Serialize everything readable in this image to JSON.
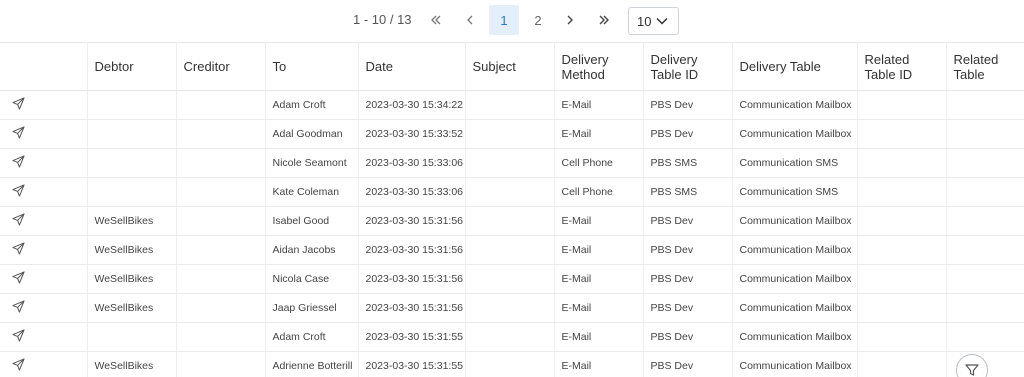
{
  "pager": {
    "range": "1 - 10 / 13",
    "first_label": "«",
    "prev_label": "‹",
    "pages": [
      "1",
      "2"
    ],
    "next_label": "›",
    "last_label": "»",
    "page_size": "10"
  },
  "table": {
    "headers": [
      "",
      "Debtor",
      "Creditor",
      "To",
      "Date",
      "Subject",
      "Delivery Method",
      "Delivery Table ID",
      "Delivery Table",
      "Related Table ID",
      "Related Table"
    ],
    "rows": [
      {
        "debtor": "",
        "creditor": "",
        "to": "Adam Croft",
        "date": "2023-03-30 15:34:22",
        "subject": "",
        "method": "E-Mail",
        "table_id": "PBS Dev",
        "table": "Communication Mailbox",
        "rel_id": "",
        "rel_table": ""
      },
      {
        "debtor": "",
        "creditor": "",
        "to": "Adal Goodman",
        "date": "2023-03-30 15:33:52",
        "subject": "",
        "method": "E-Mail",
        "table_id": "PBS Dev",
        "table": "Communication Mailbox",
        "rel_id": "",
        "rel_table": ""
      },
      {
        "debtor": "",
        "creditor": "",
        "to": "Nicole Seamont",
        "date": "2023-03-30 15:33:06",
        "subject": "",
        "method": "Cell Phone",
        "table_id": "PBS SMS",
        "table": "Communication SMS",
        "rel_id": "",
        "rel_table": ""
      },
      {
        "debtor": "",
        "creditor": "",
        "to": "Kate Coleman",
        "date": "2023-03-30 15:33:06",
        "subject": "",
        "method": "Cell Phone",
        "table_id": "PBS SMS",
        "table": "Communication SMS",
        "rel_id": "",
        "rel_table": ""
      },
      {
        "debtor": "WeSellBikes",
        "creditor": "",
        "to": "Isabel Good",
        "date": "2023-03-30 15:31:56",
        "subject": "",
        "method": "E-Mail",
        "table_id": "PBS Dev",
        "table": "Communication Mailbox",
        "rel_id": "",
        "rel_table": ""
      },
      {
        "debtor": "WeSellBikes",
        "creditor": "",
        "to": "Aidan Jacobs",
        "date": "2023-03-30 15:31:56",
        "subject": "",
        "method": "E-Mail",
        "table_id": "PBS Dev",
        "table": "Communication Mailbox",
        "rel_id": "",
        "rel_table": ""
      },
      {
        "debtor": "WeSellBikes",
        "creditor": "",
        "to": "Nicola Case",
        "date": "2023-03-30 15:31:56",
        "subject": "",
        "method": "E-Mail",
        "table_id": "PBS Dev",
        "table": "Communication Mailbox",
        "rel_id": "",
        "rel_table": ""
      },
      {
        "debtor": "WeSellBikes",
        "creditor": "",
        "to": "Jaap Griessel",
        "date": "2023-03-30 15:31:56",
        "subject": "",
        "method": "E-Mail",
        "table_id": "PBS Dev",
        "table": "Communication Mailbox",
        "rel_id": "",
        "rel_table": ""
      },
      {
        "debtor": "",
        "creditor": "",
        "to": "Adam Croft",
        "date": "2023-03-30 15:31:55",
        "subject": "",
        "method": "E-Mail",
        "table_id": "PBS Dev",
        "table": "Communication Mailbox",
        "rel_id": "",
        "rel_table": ""
      },
      {
        "debtor": "WeSellBikes",
        "creditor": "",
        "to": "Adrienne Botterill",
        "date": "2023-03-30 15:31:55",
        "subject": "",
        "method": "E-Mail",
        "table_id": "PBS Dev",
        "table": "Communication Mailbox",
        "rel_id": "",
        "rel_table": ""
      }
    ]
  },
  "icons": {
    "row_icon": "send-icon",
    "fab_icon": "filter-icon"
  },
  "colors": {
    "active_page_bg": "#e3effb",
    "active_page_text": "#2b79c9",
    "border": "#e4e6ea"
  }
}
